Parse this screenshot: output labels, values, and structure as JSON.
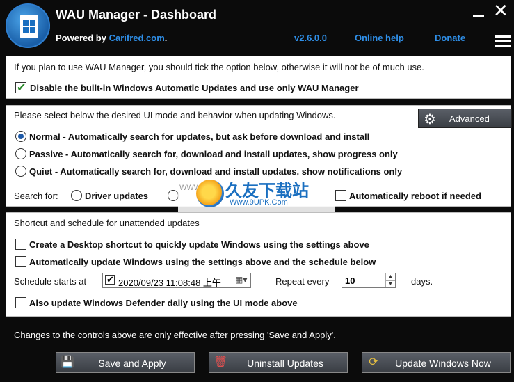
{
  "header": {
    "title": "WAU Manager - Dashboard",
    "powered_prefix": "Powered by ",
    "powered_link": "Carifred.com",
    "powered_suffix": ".",
    "version": "v2.6.0.0",
    "online_help": "Online help",
    "donate": "Donate",
    "close_glyph": "✕"
  },
  "panel1": {
    "info": "If you plan to use WAU Manager, you should tick the option below, otherwise it will not be of much use.",
    "disable_label": "Disable the built-in Windows Automatic Updates and use only WAU Manager",
    "disable_checked": true
  },
  "panel2": {
    "intro": "Please select below the desired UI mode and behavior when updating Windows.",
    "advanced_label": "Advanced",
    "modes": [
      {
        "label": "Normal - Automatically search for updates, but ask before download and install",
        "selected": true
      },
      {
        "label": "Passive - Automatically search for, download and install updates, show progress only",
        "selected": false
      },
      {
        "label": "Quiet - Automatically search for, download and install updates, show notifications only",
        "selected": false
      }
    ],
    "search_for": "Search for:",
    "driver_updates": "Driver updates",
    "auto_reboot": "Automatically reboot if needed"
  },
  "panel3": {
    "heading": "Shortcut and schedule for unattended updates",
    "create_shortcut": "Create a Desktop shortcut to quickly update Windows using the settings above",
    "auto_update": "Automatically update Windows using the settings above and the schedule below",
    "schedule_starts": "Schedule starts at",
    "schedule_value": "2020/09/23  11:08:48 上午",
    "repeat_every": "Repeat every",
    "repeat_value": "10",
    "days": "days.",
    "defender": "Also update Windows Defender daily using the UI mode above"
  },
  "watermark": {
    "title": "久友下载站",
    "url": "Www.9UPK.Com",
    "www": "WWW.9U"
  },
  "footer": {
    "note": "Changes to the controls above are only effective after pressing 'Save and Apply'.",
    "save_apply": "Save and Apply",
    "uninstall": "Uninstall Updates",
    "update_now": "Update Windows Now"
  }
}
